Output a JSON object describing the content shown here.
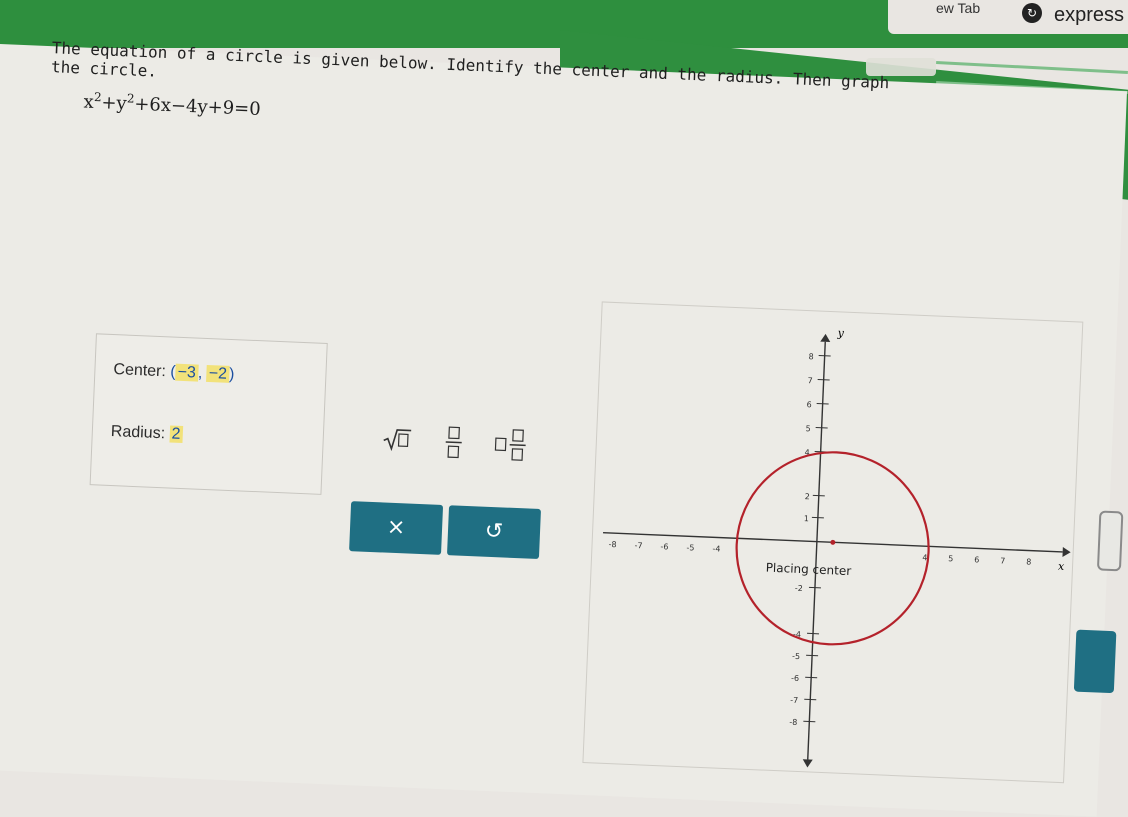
{
  "browser": {
    "tab_label": "ew Tab",
    "extension_label": "express",
    "extension_icon": "circle-arrow-icon"
  },
  "question": {
    "text": "The equation of a circle is given below. Identify the center and the radius. Then graph the circle.",
    "equation_parts": {
      "x": "x",
      "x_exp": "2",
      "plus1": "+",
      "y": "y",
      "y_exp": "2",
      "rest": "+6x−4y+9=0"
    }
  },
  "answer": {
    "center_label": "Center:",
    "center_x": "−3",
    "center_y": "−2",
    "radius_label": "Radius:",
    "radius_value": "2"
  },
  "toolbar": {
    "sqrt_icon": "sqrt-icon",
    "fraction_icon": "fraction-icon",
    "mixed_number_icon": "mixed-number-icon",
    "clear_label": "×",
    "undo_label": "↺"
  },
  "graph": {
    "x_axis_label": "x",
    "y_axis_label": "y",
    "x_ticks": [
      "-8",
      "-7",
      "-6",
      "-5",
      "-4",
      "4",
      "5",
      "6",
      "7",
      "8"
    ],
    "y_ticks": [
      "8",
      "7",
      "6",
      "5",
      "4",
      "2",
      "1",
      "-2",
      "-4",
      "-5",
      "-6",
      "-7",
      "-8"
    ],
    "status_text": "Placing center",
    "circle_color": "#b4222b",
    "axis_color": "#333333"
  },
  "colors": {
    "header_green": "#2e8f3e",
    "button_teal": "#1f6f83",
    "highlight_yellow": "#f2e27a"
  }
}
